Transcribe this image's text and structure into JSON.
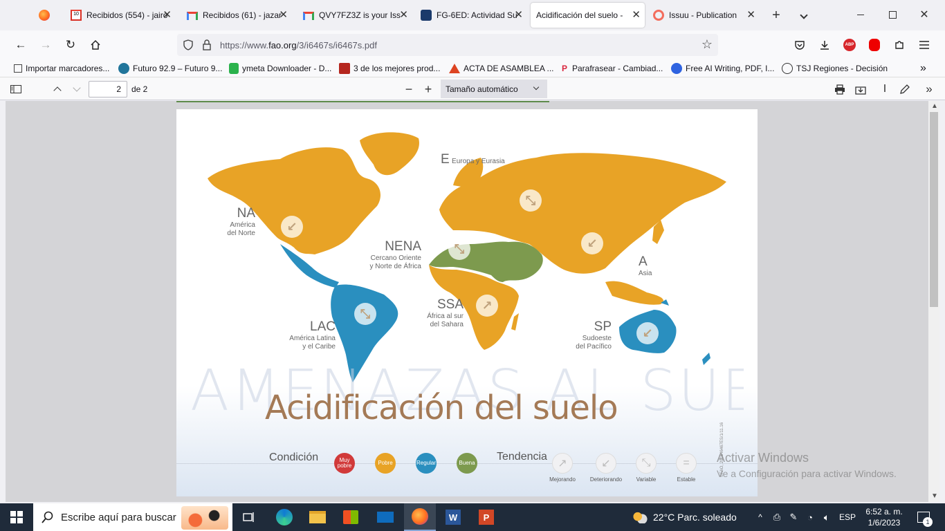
{
  "tabs": [
    {
      "title": "Recibidos (554) - jairo",
      "icon": "gmail-icon"
    },
    {
      "title": "Recibidos (61) - jazar",
      "icon": "gmail-icon"
    },
    {
      "title": "QVY7FZ3Z is your Iss",
      "icon": "gmail-icon"
    },
    {
      "title": "FG-6ED: Actividad Su",
      "icon": "fg-icon"
    },
    {
      "title": "Acidificación del suelo -",
      "icon": "none",
      "active": true
    },
    {
      "title": "Issuu - Publication",
      "icon": "issuu-icon"
    }
  ],
  "navbar": {
    "url_prefix": "https://www.",
    "url_domain": "fao.org",
    "url_path": "/3/i6467s/i6467s.pdf"
  },
  "bookmarks": [
    {
      "label": "Importar marcadores...",
      "icon": "import-icon"
    },
    {
      "label": "Futuro 92.9 – Futuro 9...",
      "icon": "wordpress-icon"
    },
    {
      "label": "ymeta Downloader - D...",
      "icon": "download-icon"
    },
    {
      "label": "3 de los mejores prod...",
      "icon": "red-icon"
    },
    {
      "label": "ACTA DE ASAMBLEA ...",
      "icon": "red-triangle-icon"
    },
    {
      "label": "Parafrasear - Cambiad...",
      "icon": "p-icon"
    },
    {
      "label": "Free AI Writing, PDF, I...",
      "icon": "blue-icon"
    },
    {
      "label": "TSJ Regiones - Decisión",
      "icon": "globe-icon"
    }
  ],
  "pdf_toolbar": {
    "page_number": "2",
    "page_total": "de 2",
    "zoom": "Tamaño automático"
  },
  "map": {
    "regions": [
      {
        "code": "NA",
        "name_l1": "América",
        "name_l2": "del Norte"
      },
      {
        "code": "E",
        "name_l1": "Europa y Eurasia"
      },
      {
        "code": "NENA",
        "name_l1": "Cercano Oriente",
        "name_l2": "y Norte de África"
      },
      {
        "code": "A",
        "name_l1": "Asia"
      },
      {
        "code": "SSA",
        "name_l1": "África al sur",
        "name_l2": "del Sahara"
      },
      {
        "code": "LAC",
        "name_l1": "América Latina",
        "name_l2": "y el Caribe"
      },
      {
        "code": "SP",
        "name_l1": "Sudoeste",
        "name_l2": "del Pacífico"
      }
    ],
    "bg_title": "AMENAZAS AL SUELO",
    "title": "Acidificación del suelo",
    "condition_label": "Condición",
    "conditions": [
      {
        "label": "Muy pobre",
        "color": "#d13a3a"
      },
      {
        "label": "Pobre",
        "color": "#e8a326"
      },
      {
        "label": "Regular",
        "color": "#2a8fbf"
      },
      {
        "label": "Buena",
        "color": "#7d9a4e"
      }
    ],
    "trend_label": "Tendencia",
    "trends": [
      {
        "label": "Mejorando",
        "glyph": "↗"
      },
      {
        "label": "Deteriorando",
        "glyph": "↙"
      },
      {
        "label": "Variable",
        "glyph": "⤡"
      },
      {
        "label": "Estable",
        "glyph": "="
      }
    ],
    "copyright": "©FAO, 2016  I6467ES/1/11.16"
  },
  "watermark": {
    "line1": "Activar Windows",
    "line2": "Ve a Configuración para activar Windows."
  },
  "taskbar": {
    "search_placeholder": "Escribe aquí para buscar",
    "weather": "22°C  Parc. soleado",
    "lang": "ESP",
    "time": "6:52 a. m.",
    "date": "1/6/2023",
    "notifications": "1"
  }
}
